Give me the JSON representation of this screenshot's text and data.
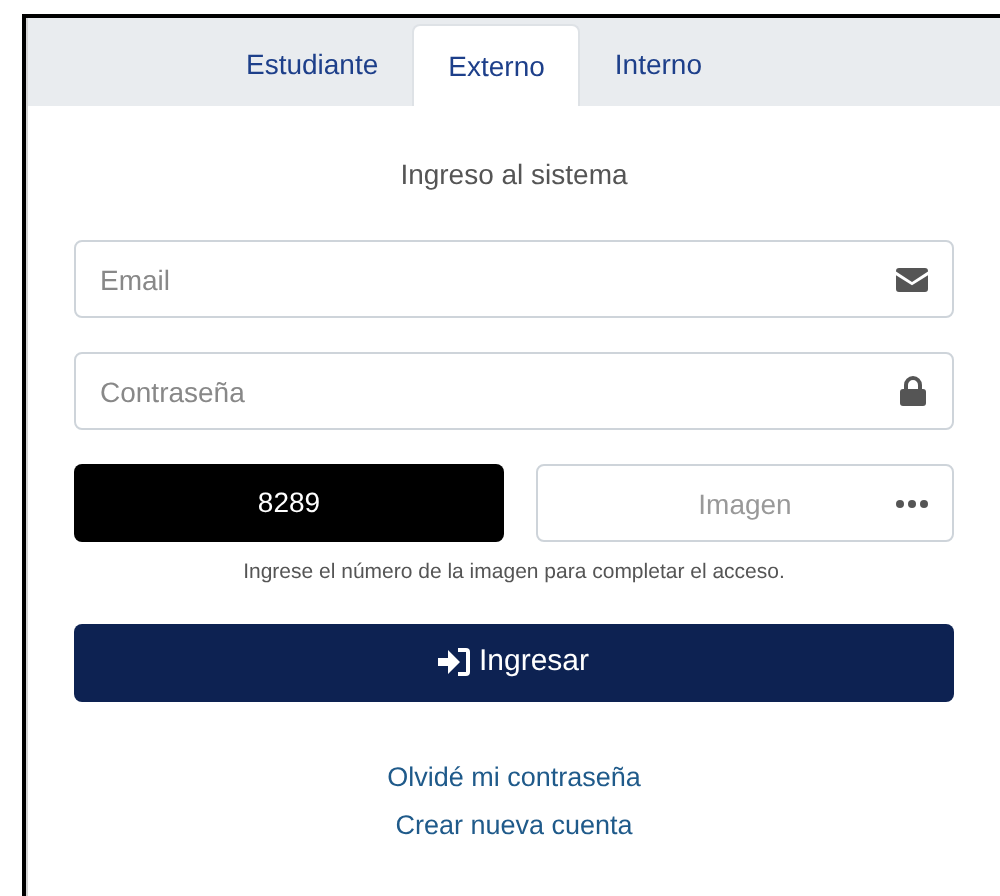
{
  "tabs": [
    {
      "label": "Estudiante",
      "selected": false
    },
    {
      "label": "Externo",
      "selected": true
    },
    {
      "label": "Interno",
      "selected": false
    }
  ],
  "heading": "Ingreso al sistema",
  "fields": [
    {
      "kind": "email",
      "placeholder": "Email"
    },
    {
      "kind": "password",
      "placeholder": "Contraseña"
    }
  ],
  "captcha": {
    "code": "8289",
    "placeholder": "Imagen",
    "hint": "Ingrese el número de la imagen para completar el acceso."
  },
  "submit_button": "Ingresar",
  "links": [
    "Olvidé mi contraseña",
    "Crear nueva cuenta"
  ]
}
